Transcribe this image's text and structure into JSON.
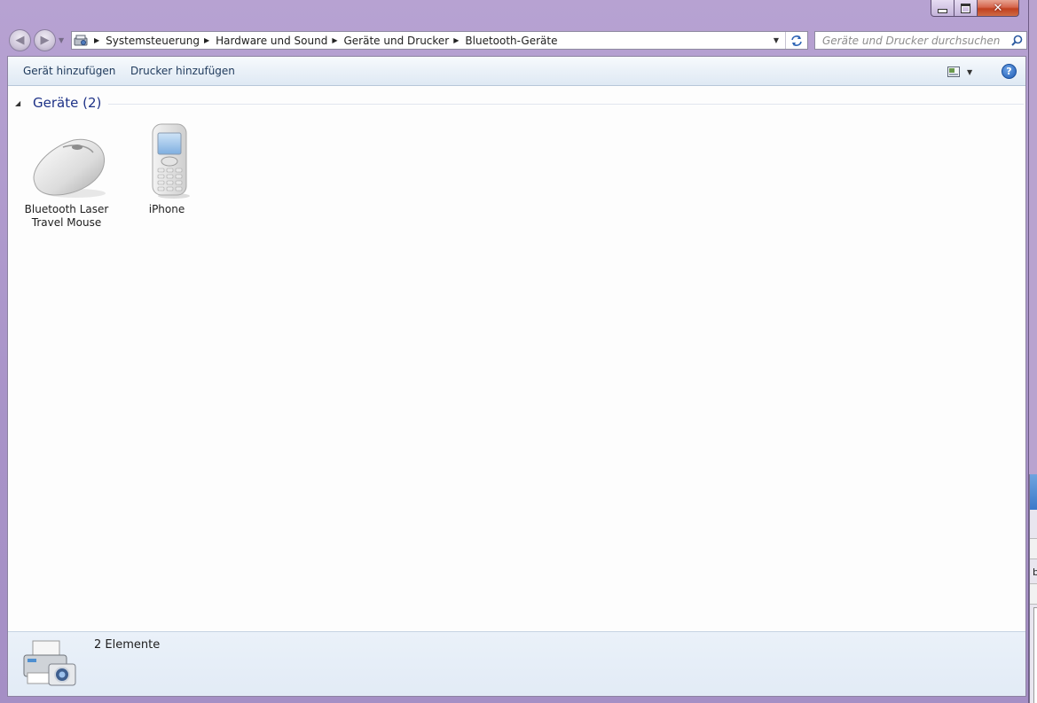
{
  "window": {
    "caption": {
      "minimize": "minimize",
      "maximize": "maximize",
      "close": "close"
    }
  },
  "address_bar": {
    "breadcrumbs": [
      "Systemsteuerung",
      "Hardware und Sound",
      "Geräte und Drucker",
      "Bluetooth-Geräte"
    ]
  },
  "search": {
    "placeholder": "Geräte und Drucker durchsuchen",
    "value": ""
  },
  "toolbar": {
    "add_device": "Gerät hinzufügen",
    "add_printer": "Drucker hinzufügen"
  },
  "group": {
    "title": "Geräte (2)"
  },
  "devices": [
    {
      "label_line1": "Bluetooth Laser",
      "label_line2": "Travel Mouse",
      "icon": "mouse-icon"
    },
    {
      "label": "iPhone",
      "icon": "mobile-phone-icon"
    }
  ],
  "status": {
    "count_text": "2 Elemente",
    "icon": "printer-camera-icon"
  },
  "side_window": {
    "partial_text": "b"
  },
  "colors": {
    "frame": "#a893c8",
    "group_title": "#1e3287",
    "toolbar_text": "#1e395b",
    "close_button": "#c0401f"
  }
}
